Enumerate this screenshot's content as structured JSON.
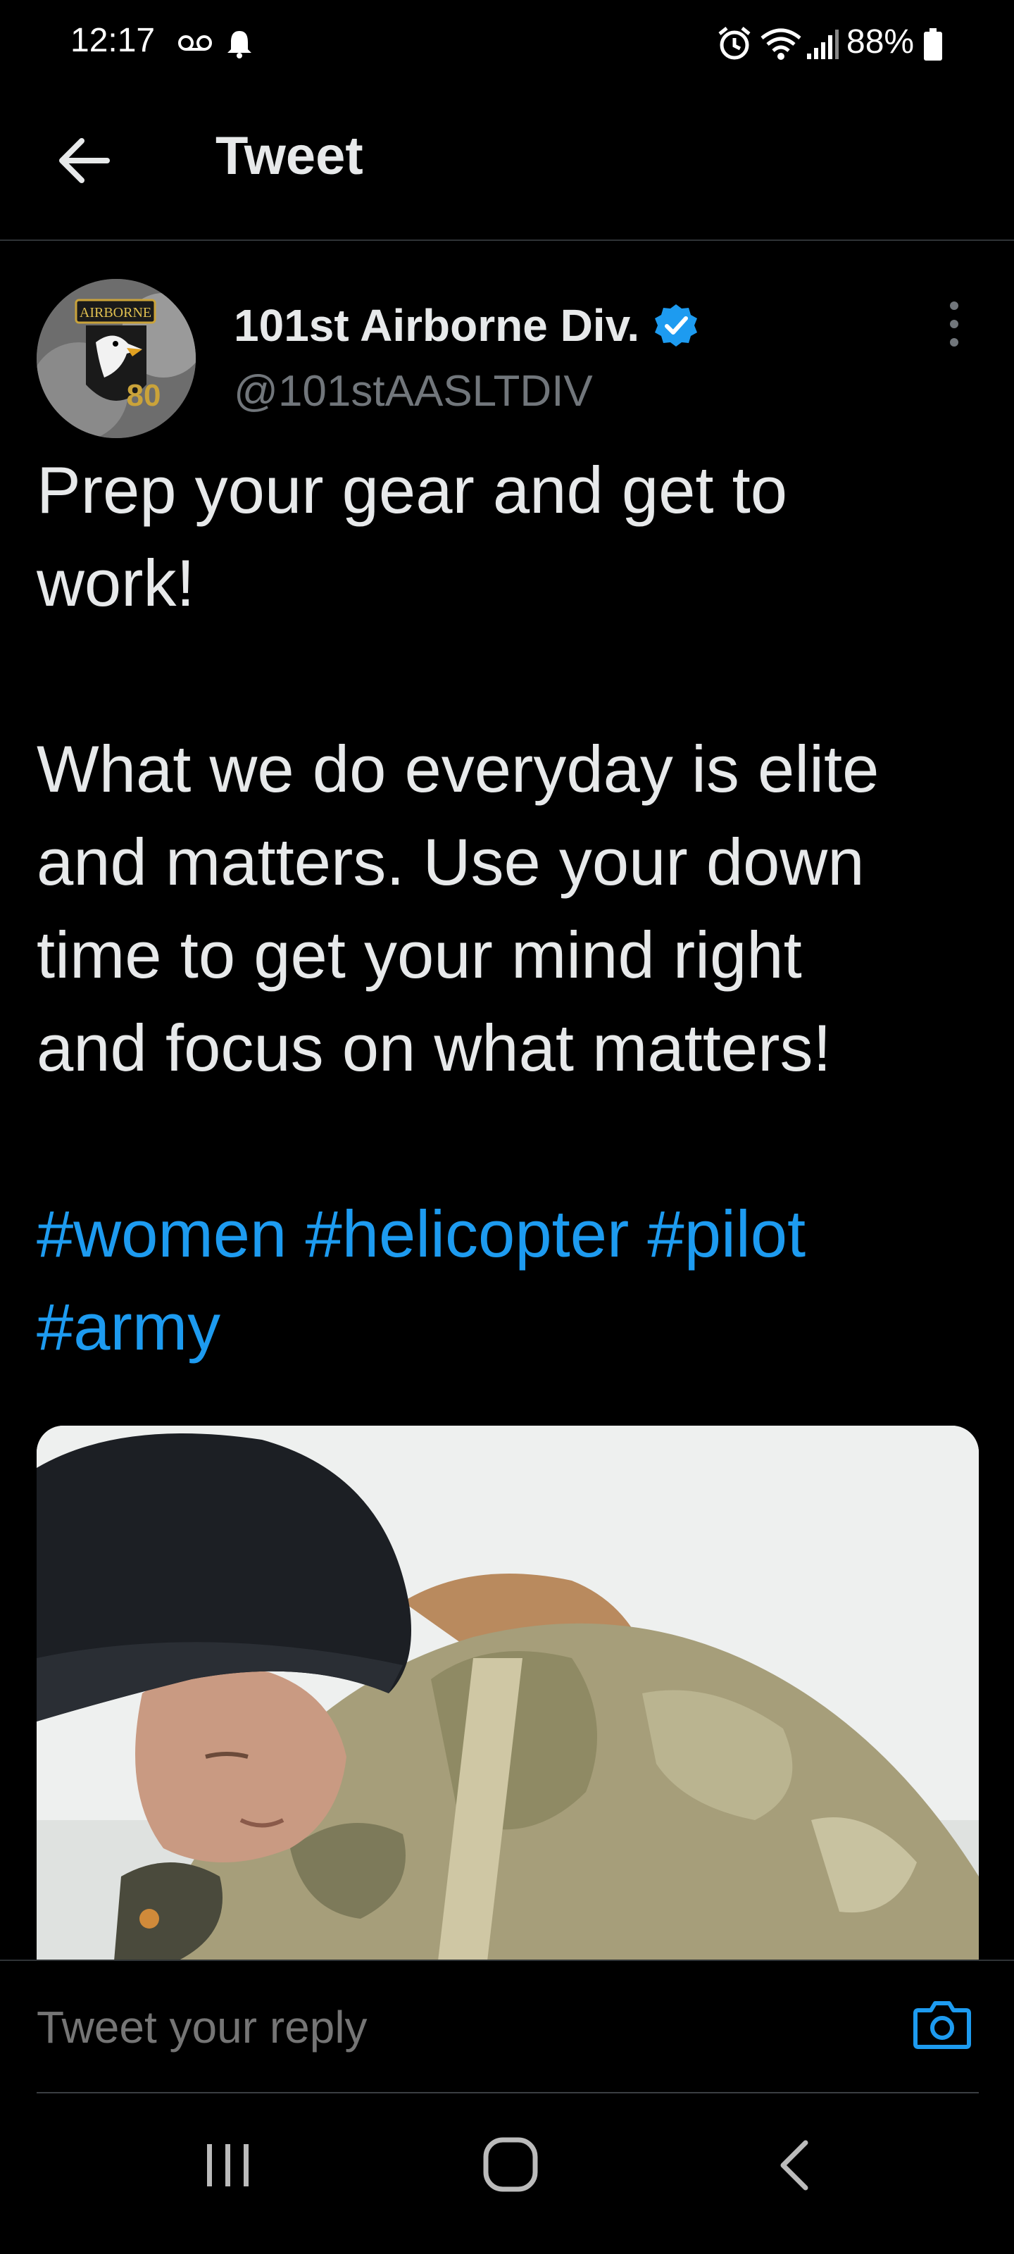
{
  "status_bar": {
    "time": "12:17",
    "battery": "88%"
  },
  "header": {
    "title": "Tweet"
  },
  "tweet": {
    "author_name": "101st Airborne Div.",
    "author_handle": "@101stAASLTDIV",
    "text_lines": [
      "Prep your gear and get to",
      "work!",
      "",
      "What we do everyday is elite",
      "and matters. Use your down",
      "time to get your mind right",
      "and focus on what matters!"
    ],
    "hashtags": [
      "#women",
      "#helicopter",
      "#pilot",
      "#army"
    ],
    "avatar_badge_text": "AIRBORNE",
    "avatar_number": "80"
  },
  "reply": {
    "placeholder": "Tweet your reply"
  },
  "colors": {
    "background": "#000000",
    "text": "#e7e9ea",
    "secondary": "#71767b",
    "accent": "#1d9bf0"
  }
}
